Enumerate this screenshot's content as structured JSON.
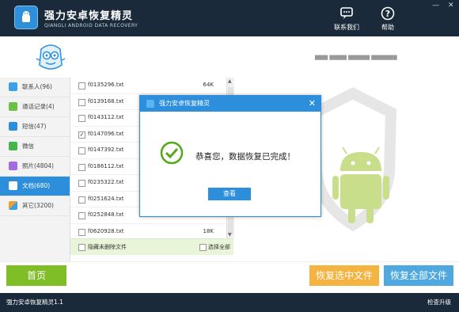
{
  "app": {
    "title": "强力安卓恢复精灵",
    "subtitle": "QIANGLI ANDROID DATA RECOVERY",
    "brand_color": "#2d8fdb",
    "titlebar_color": "#1a2a3a"
  },
  "window_controls": {
    "minimize": "—",
    "close": "✕"
  },
  "header_buttons": [
    {
      "label": "联系我们",
      "icon": "contact-icon"
    },
    {
      "label": "帮助",
      "icon": "help-icon"
    }
  ],
  "user_info": "▆▆▆ ▆▆▆▆ ▆▆▆▆▆ ▆▆▆▆▆▆",
  "sidebar": {
    "items": [
      {
        "label": "联系人(96)",
        "icon": "contacts-icon",
        "color": "#3aa0e8"
      },
      {
        "label": "通话记录(4)",
        "icon": "call-log-icon",
        "color": "#6cc04a"
      },
      {
        "label": "短信(47)",
        "icon": "sms-icon",
        "color": "#2d8fdb"
      },
      {
        "label": "微信",
        "icon": "wechat-icon",
        "color": "#44b549"
      },
      {
        "label": "照片(4804)",
        "icon": "photo-icon",
        "color": "#a56be0"
      },
      {
        "label": "文档(680)",
        "icon": "document-icon",
        "color": "#ffffff"
      },
      {
        "label": "其它(3200)",
        "icon": "other-icon",
        "color": "#f0a030"
      }
    ],
    "active_index": 5
  },
  "files": {
    "rows": [
      {
        "name": "f0135296.txt",
        "size": "64K",
        "checked": false
      },
      {
        "name": "f0139168.txt",
        "size": "",
        "checked": false
      },
      {
        "name": "f0143112.txt",
        "size": "",
        "checked": false
      },
      {
        "name": "f0147096.txt",
        "size": "",
        "checked": true
      },
      {
        "name": "f0147392.txt",
        "size": "",
        "checked": false
      },
      {
        "name": "f0186112.txt",
        "size": "",
        "checked": false
      },
      {
        "name": "f0235322.txt",
        "size": "",
        "checked": false
      },
      {
        "name": "f0251624.txt",
        "size": "",
        "checked": false
      },
      {
        "name": "f0252848.txt",
        "size": "",
        "checked": false
      },
      {
        "name": "f0620928.txt",
        "size": "18K",
        "checked": false
      }
    ]
  },
  "options": {
    "hide_undeleted": "隐藏未删除文件",
    "select_all": "选择全部"
  },
  "dialog": {
    "title": "强力安卓恢复精灵",
    "message": "恭喜您，数据恢复已完成！",
    "view_button": "查看",
    "close": "✕"
  },
  "bottom": {
    "home": "首页",
    "recover_selected": "恢复选中文件",
    "recover_all": "恢复全部文件"
  },
  "status": {
    "version": "强力安卓恢复精灵1.1",
    "check_update": "检查升级"
  }
}
